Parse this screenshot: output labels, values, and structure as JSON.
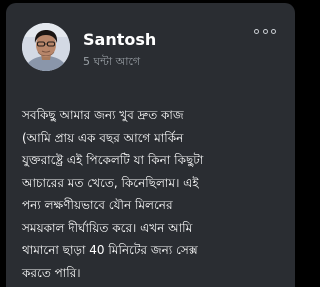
{
  "post": {
    "author": "Santosh",
    "time": "5 ঘন্টা আগে",
    "menu_icon": "more-horizontal-icon",
    "body": "সবকিছু আমার জন্য খুব দ্রুত কাজ\n(আমি প্রায় এক বছর আগে মার্কিন\nযুক্তরাষ্ট্রে এই পিকেলটি যা কিনা কিছুটা\nআচারের মত খেতে, কিনেছিলাম। এই\nপন্য লক্ষণীয়ভাবে যৌন মিলনের\nসময়কাল দীর্ঘায়িত করে। এখন আমি\nথামানো ছাড়া 40 মিনিটের জন্য সেক্স\nকরতে পারি।"
  },
  "colors": {
    "page_background": "#000000",
    "card_background": "#2a2d32",
    "primary_text": "#ffffff",
    "secondary_text": "#9aa0a6"
  }
}
